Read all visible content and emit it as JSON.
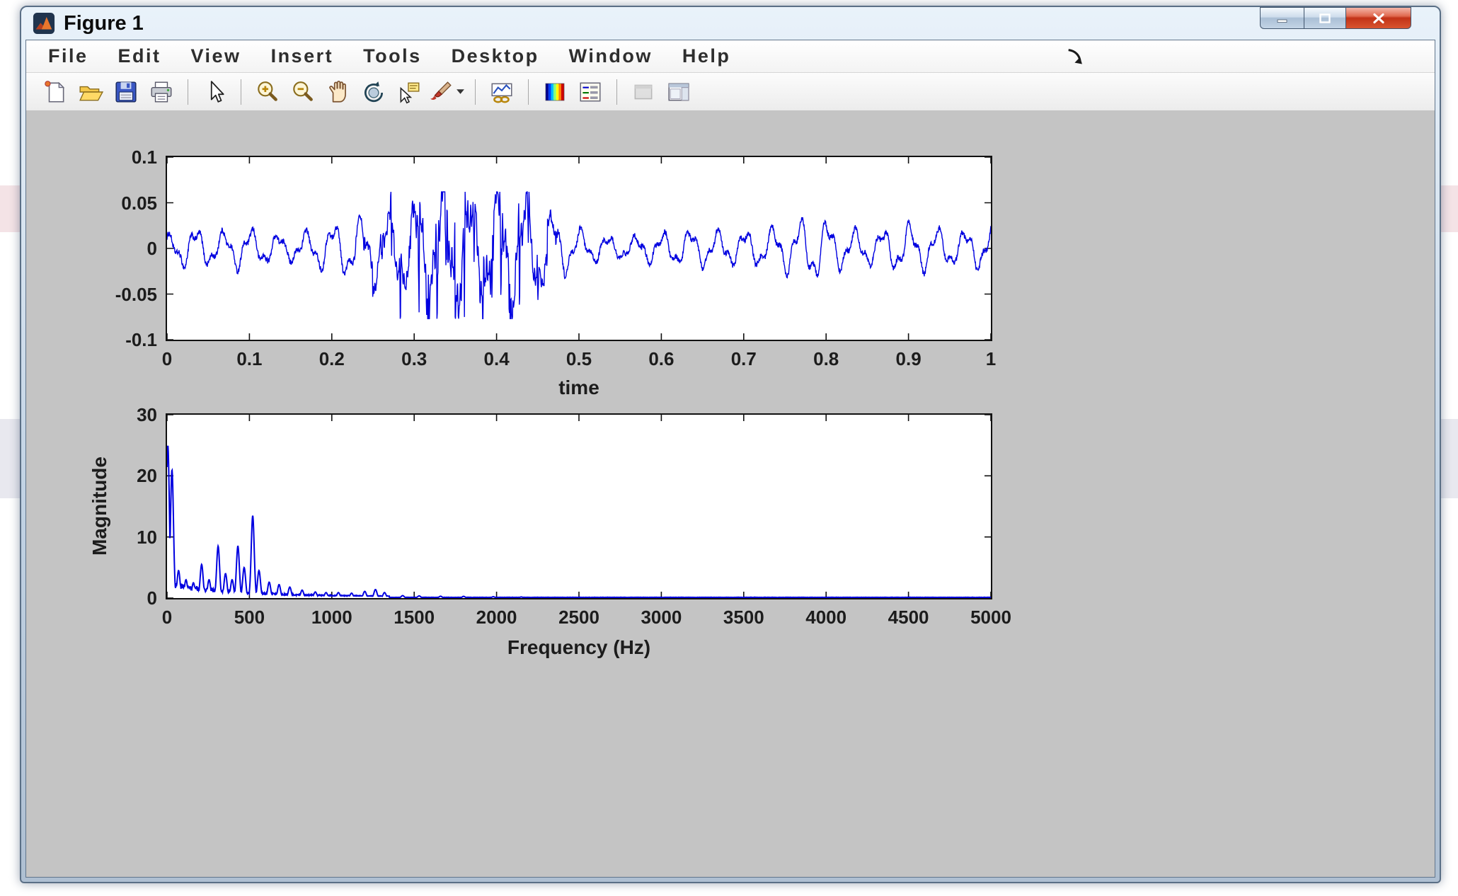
{
  "window": {
    "title": "Figure 1",
    "controls": [
      "minimize",
      "maximize",
      "close"
    ]
  },
  "menu_bar": {
    "items": [
      "File",
      "Edit",
      "View",
      "Insert",
      "Tools",
      "Desktop",
      "Window",
      "Help"
    ]
  },
  "toolbar": {
    "groups": [
      {
        "buttons": [
          {
            "icon": "new-figure-icon"
          },
          {
            "icon": "open-file-icon"
          },
          {
            "icon": "save-figure-icon"
          },
          {
            "icon": "print-figure-icon"
          }
        ]
      },
      {
        "buttons": [
          {
            "icon": "edit-plot-arrow-icon"
          }
        ]
      },
      {
        "buttons": [
          {
            "icon": "zoom-in-icon"
          },
          {
            "icon": "zoom-out-icon"
          },
          {
            "icon": "pan-hand-icon"
          },
          {
            "icon": "rotate-3d-icon"
          },
          {
            "icon": "data-cursor-icon"
          },
          {
            "icon": "brush-data-icon",
            "has_dropdown": true
          }
        ]
      },
      {
        "buttons": [
          {
            "icon": "link-plot-icon"
          }
        ]
      },
      {
        "buttons": [
          {
            "icon": "insert-colorbar-icon"
          },
          {
            "icon": "insert-legend-icon"
          }
        ]
      },
      {
        "buttons": [
          {
            "icon": "hide-plot-tools-icon",
            "disabled": true
          },
          {
            "icon": "show-plot-tools-icon"
          }
        ]
      }
    ]
  },
  "colors": {
    "figure_background": "#c4c4c4",
    "plot_background": "#ffffff",
    "plot_line": "#0000e0",
    "axis_text": "#1c1c1c",
    "close_button_red": "#c23318"
  },
  "chart_data": [
    {
      "type": "line",
      "title": "",
      "xlabel": "time",
      "ylabel": "",
      "xlim": [
        0,
        1
      ],
      "ylim": [
        -0.1,
        0.1
      ],
      "xticks": [
        0,
        0.1,
        0.2,
        0.3,
        0.4,
        0.5,
        0.6,
        0.7,
        0.8,
        0.9,
        1
      ],
      "yticks": [
        0.1,
        0.05,
        0,
        -0.05,
        -0.1
      ],
      "grid": false,
      "legend": "none",
      "line_color": "#0000e0",
      "description": "Speech time-domain waveform: quiet oscillation around 0 (about +/-0.02) with a dense high-frequency burst between t=0.23 and t=0.48 peaking near +0.06 and dipping to about -0.075",
      "signal": {
        "envelope_points": [
          [
            0,
            0.013
          ],
          [
            0.03,
            0.022
          ],
          [
            0.06,
            0.016
          ],
          [
            0.09,
            0.022
          ],
          [
            0.12,
            0.016
          ],
          [
            0.15,
            0.013
          ],
          [
            0.18,
            0.02
          ],
          [
            0.21,
            0.028
          ],
          [
            0.24,
            0.034
          ],
          [
            0.27,
            0.04
          ],
          [
            0.3,
            0.048
          ],
          [
            0.33,
            0.062
          ],
          [
            0.36,
            0.058
          ],
          [
            0.39,
            0.055
          ],
          [
            0.42,
            0.063
          ],
          [
            0.45,
            0.05
          ],
          [
            0.48,
            0.028
          ],
          [
            0.51,
            0.016
          ],
          [
            0.55,
            0.011
          ],
          [
            0.6,
            0.016
          ],
          [
            0.64,
            0.02
          ],
          [
            0.68,
            0.017
          ],
          [
            0.72,
            0.019
          ],
          [
            0.76,
            0.028
          ],
          [
            0.79,
            0.034
          ],
          [
            0.82,
            0.02
          ],
          [
            0.86,
            0.017
          ],
          [
            0.9,
            0.026
          ],
          [
            0.93,
            0.022
          ],
          [
            0.96,
            0.017
          ],
          [
            1,
            0.024
          ]
        ],
        "burst_region": [
          0.225,
          0.485
        ],
        "base_freq_hz": 30,
        "burst_freq_hz": 310,
        "pitch_hz": 90
      }
    },
    {
      "type": "line",
      "title": "",
      "xlabel": "Frequency (Hz)",
      "ylabel": "Magnitude",
      "xlim": [
        0,
        5000
      ],
      "ylim": [
        0,
        30
      ],
      "xticks": [
        0,
        500,
        1000,
        1500,
        2000,
        2500,
        3000,
        3500,
        4000,
        4500,
        5000
      ],
      "yticks": [
        30,
        20,
        10,
        0
      ],
      "grid": false,
      "legend": "none",
      "line_color": "#0000e0",
      "description": "Magnitude spectrum: dominant low-frequency content below ~1300 Hz with sharp narrow peaks, essentially zero above ~1500 Hz",
      "peaks": [
        [
          5,
          25
        ],
        [
          30,
          21
        ],
        [
          70,
          4.5
        ],
        [
          115,
          3
        ],
        [
          160,
          2.5
        ],
        [
          210,
          5.5
        ],
        [
          255,
          3
        ],
        [
          310,
          8.5
        ],
        [
          355,
          4
        ],
        [
          395,
          3
        ],
        [
          430,
          8.5
        ],
        [
          468,
          5
        ],
        [
          520,
          13.5
        ],
        [
          558,
          4.5
        ],
        [
          620,
          2.6
        ],
        [
          680,
          2.2
        ],
        [
          745,
          1.8
        ],
        [
          820,
          1.3
        ],
        [
          900,
          1
        ],
        [
          965,
          0.9
        ],
        [
          1040,
          0.9
        ],
        [
          1120,
          0.8
        ],
        [
          1200,
          1.1
        ],
        [
          1265,
          1.4
        ],
        [
          1320,
          0.9
        ],
        [
          1430,
          0.4
        ],
        [
          1530,
          0.35
        ],
        [
          1660,
          0.3
        ],
        [
          1800,
          0.28
        ],
        [
          1980,
          0.22
        ],
        [
          2150,
          0.18
        ],
        [
          2400,
          0.12
        ]
      ],
      "noise_floor": "decaying jagged floor below 1350 Hz, ~0.1 flat above"
    }
  ]
}
